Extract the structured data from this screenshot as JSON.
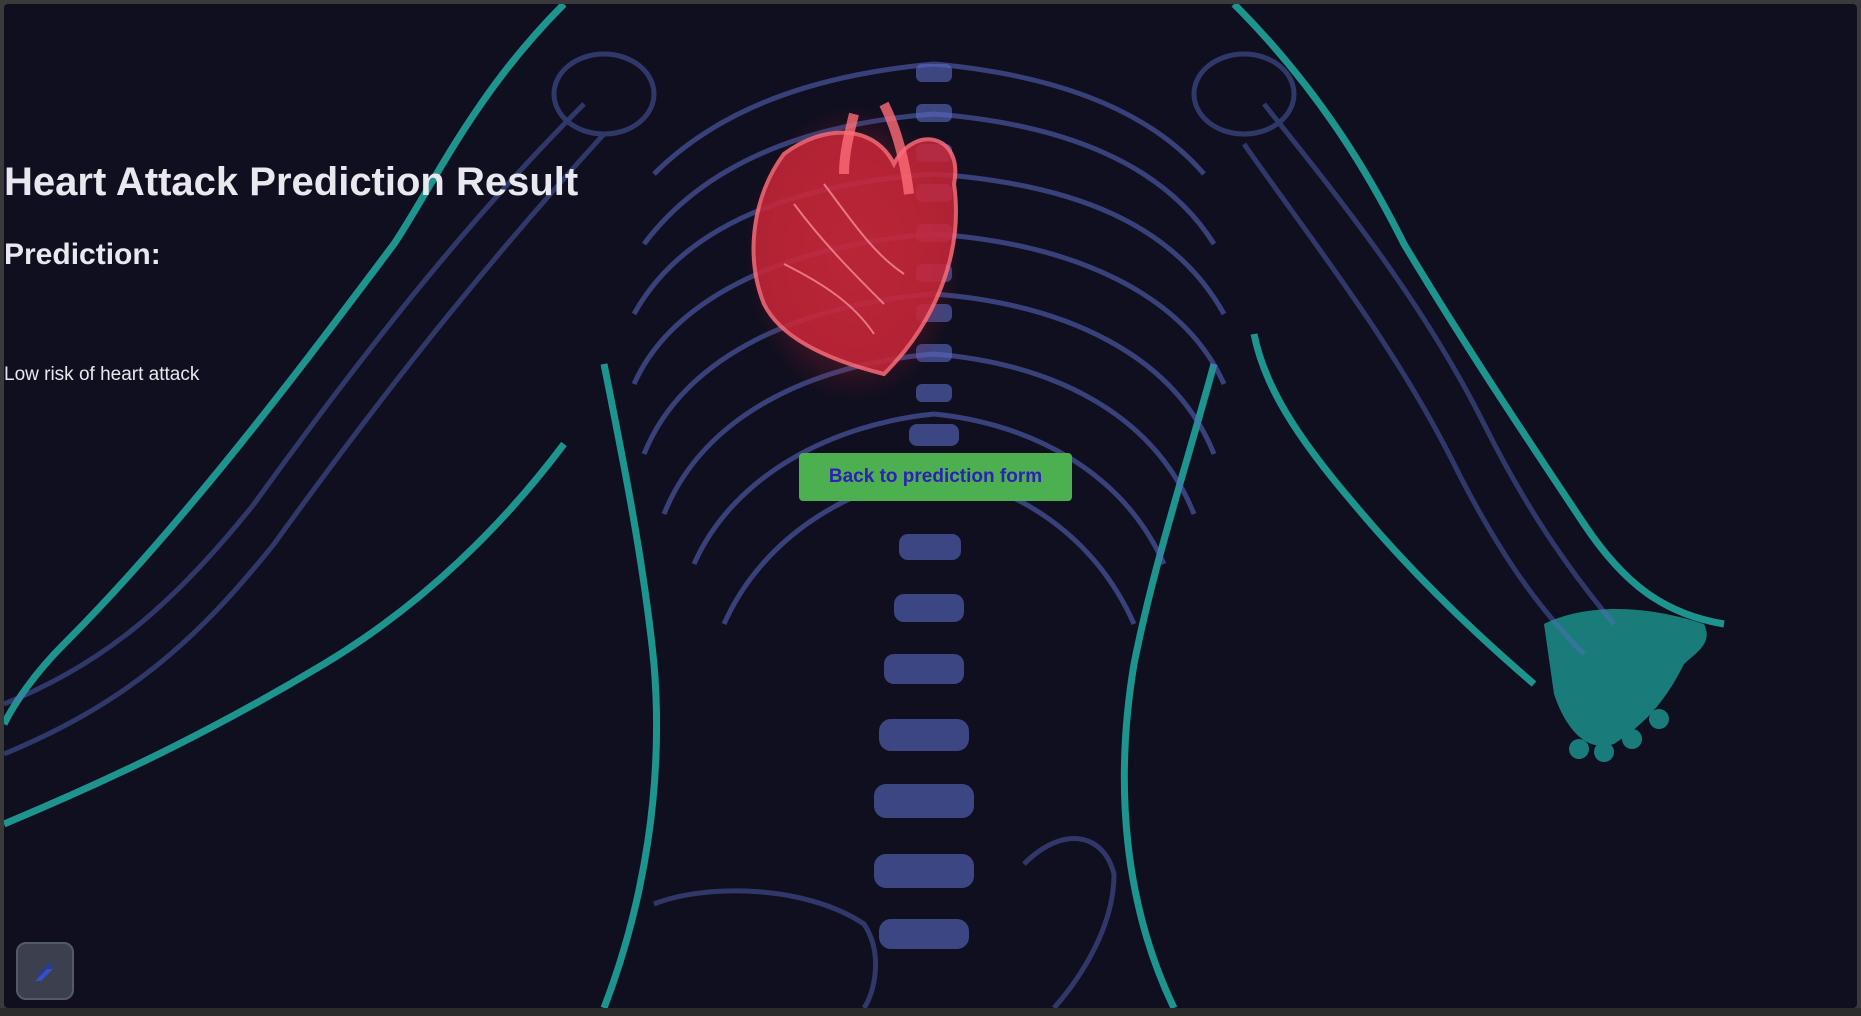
{
  "page": {
    "title": "Heart Attack Prediction Result",
    "subtitle": "Prediction:",
    "result_text": "Low risk of heart attack",
    "back_button_label": "Back to prediction form"
  },
  "colors": {
    "background": "#0f0f1f",
    "button": "#4caf50",
    "button_text": "#2f1fb8",
    "text": "#e8e8ee",
    "body_outline": "#1fa39a",
    "skeleton": "#5a6bc4",
    "heart": "#ff4d5a"
  },
  "icons": {
    "background": "anatomy-skeleton-heart-illustration",
    "corner": "app-logo-icon"
  }
}
